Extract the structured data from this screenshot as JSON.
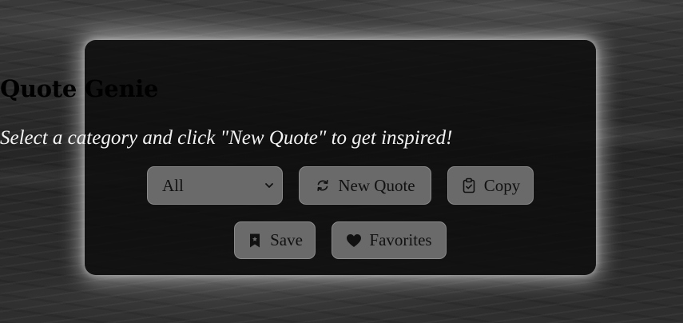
{
  "app": {
    "title": "Quote Genie",
    "subtitle": "Select a category and click \"New Quote\" to get inspired!"
  },
  "controls": {
    "category_select": {
      "selected": "All",
      "icon": "chevron-down-icon"
    },
    "new_quote": {
      "label": "New Quote",
      "icon": "refresh-icon"
    },
    "copy": {
      "label": "Copy",
      "icon": "clipboard-check-icon"
    },
    "save": {
      "label": "Save",
      "icon": "bookmark-icon"
    },
    "favorites": {
      "label": "Favorites",
      "icon": "heart-icon"
    }
  },
  "colors": {
    "card_background": "#0c0c0c",
    "button_background": "#6a6a6a",
    "text_primary": "#ffffff",
    "button_text": "#111111",
    "glow": "#ffffff"
  }
}
